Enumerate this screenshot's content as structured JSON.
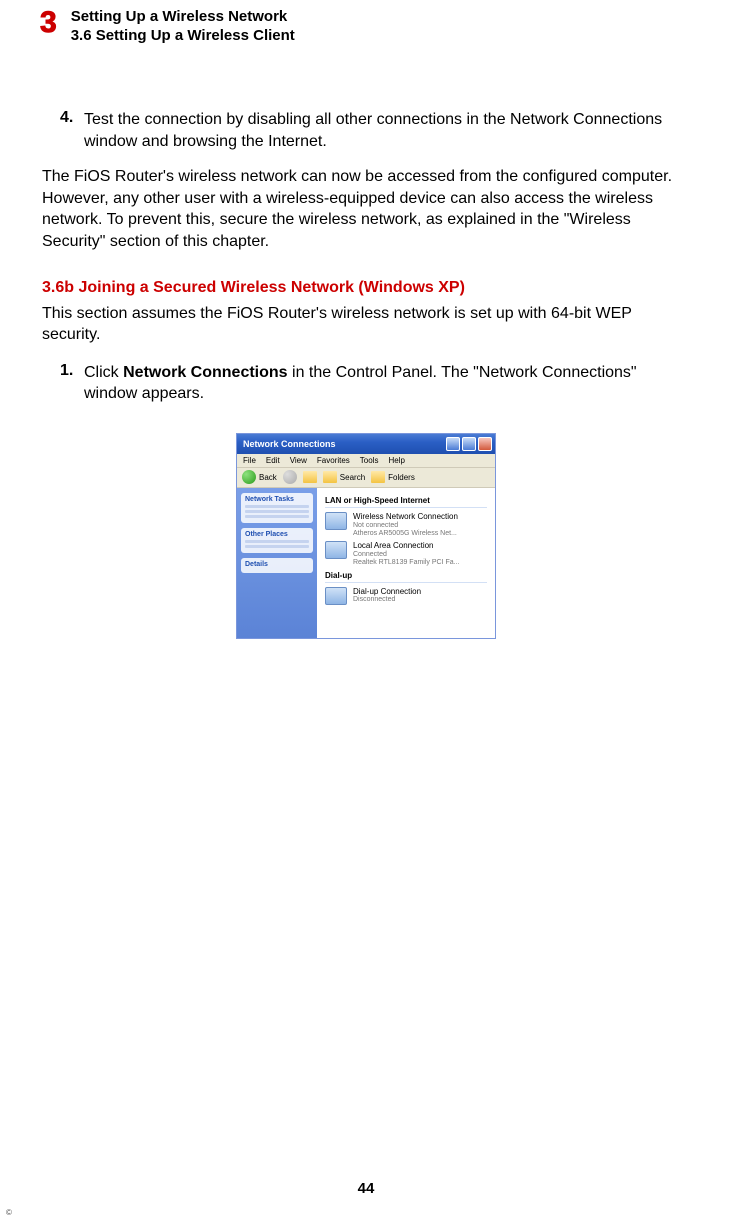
{
  "header": {
    "chapterNumber": "3",
    "chapterTitle": "Setting Up a Wireless Network",
    "sectionTitle": "3.6  Setting Up a Wireless Client"
  },
  "step4": {
    "num": "4.",
    "text": "Test the connection by disabling all other connections in the Network Connections window and browsing the Internet."
  },
  "accessPara": "The FiOS Router's wireless network can now be accessed from the configured computer. However, any other user with a wireless-equipped device can also access the wireless network. To prevent this, secure the wireless network, as explained in the \"Wireless Security\" section of this chapter.",
  "subHeading": "3.6b  Joining a Secured Wireless Network (Windows XP)",
  "introPara": "This section assumes the FiOS Router's wireless network is set up with 64-bit WEP security.",
  "step1": {
    "num": "1.",
    "pre": "Click ",
    "bold": "Network Connections",
    "post": " in the Control Panel. The \"Network Connections\" window appears."
  },
  "xp": {
    "title": "Network Connections",
    "menu": {
      "file": "File",
      "edit": "Edit",
      "view": "View",
      "fav": "Favorites",
      "tools": "Tools",
      "help": "Help"
    },
    "toolbar": {
      "back": "Back",
      "search": "Search",
      "folders": "Folders"
    },
    "side": {
      "tasks": "Network Tasks",
      "other": "Other Places",
      "details": "Details"
    },
    "group1": "LAN or High-Speed Internet",
    "wlan": {
      "name": "Wireless Network Connection",
      "status": "Not connected",
      "adapter": "Atheros AR5005G Wireless Net..."
    },
    "lan": {
      "name": "Local Area Connection",
      "status": "Connected",
      "adapter": "Realtek RTL8139 Family PCI Fa..."
    },
    "group2": "Dial-up",
    "dial": {
      "name": "Dial-up Connection",
      "status": "Disconnected"
    }
  },
  "pageNumber": "44",
  "copyright": "©"
}
